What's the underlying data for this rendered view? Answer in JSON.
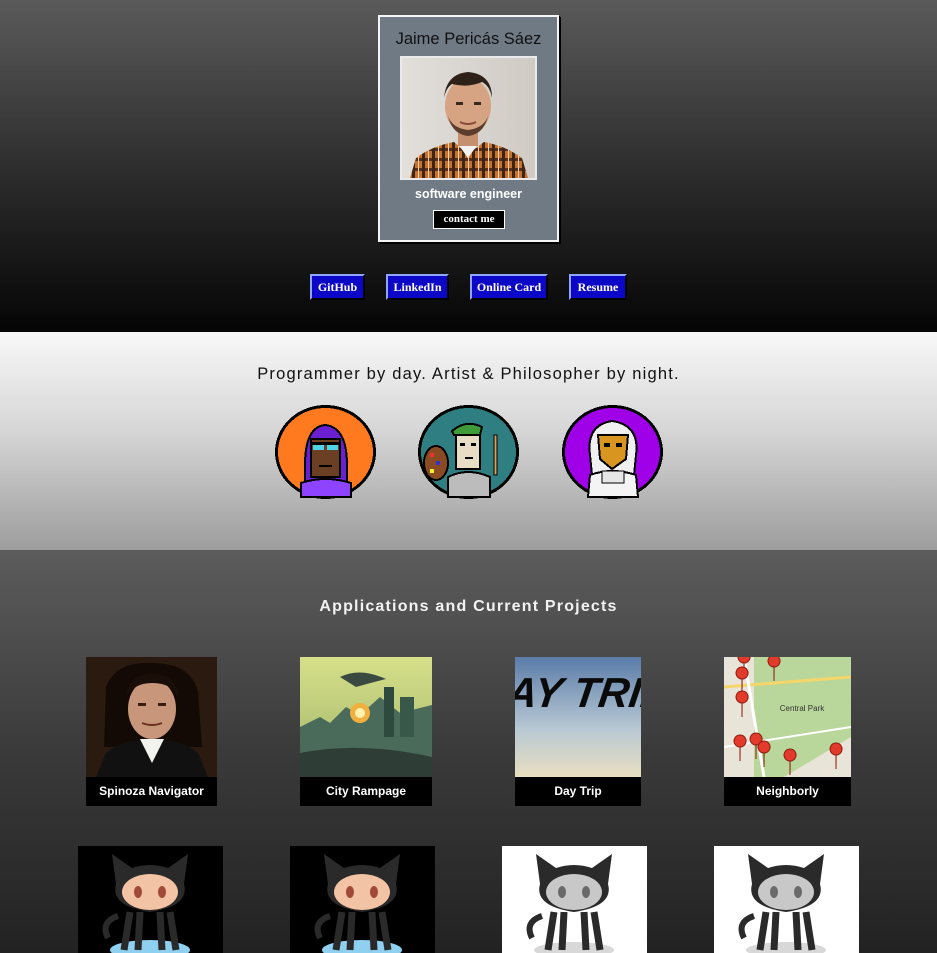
{
  "profile": {
    "name": "Jaime Pericás Sáez",
    "role": "software engineer",
    "contact_label": "contact me"
  },
  "links": [
    {
      "label": "GitHub"
    },
    {
      "label": "LinkedIn"
    },
    {
      "label": "Online Card"
    },
    {
      "label": "Resume"
    }
  ],
  "tagline": "Programmer by day. Artist & Philosopher by night.",
  "avatars": [
    {
      "name": "programmer-avatar",
      "color": "#ff7a1f"
    },
    {
      "name": "artist-avatar",
      "color": "#2f7f82"
    },
    {
      "name": "philosopher-avatar",
      "color": "#a000e8"
    }
  ],
  "projects": {
    "title": "Applications and Current Projects",
    "items": [
      {
        "label": "Spinoza Navigator",
        "icon": "spinoza-portrait"
      },
      {
        "label": "City Rampage",
        "icon": "city-rampage-art"
      },
      {
        "label": "Day Trip",
        "icon": "day-trip-logo",
        "logo_text": "DAY TRIP"
      },
      {
        "label": "Neighborly",
        "icon": "map-pins",
        "map_label": "Central Park"
      }
    ],
    "github_tiles": [
      {
        "icon": "octocat-icon",
        "theme": "dark"
      },
      {
        "icon": "octocat-icon",
        "theme": "dark"
      },
      {
        "icon": "octocat-icon",
        "theme": "light"
      },
      {
        "icon": "octocat-icon",
        "theme": "light"
      }
    ]
  },
  "colors": {
    "link_button": "#0c06c7",
    "card_bg": "#6f7a85"
  }
}
